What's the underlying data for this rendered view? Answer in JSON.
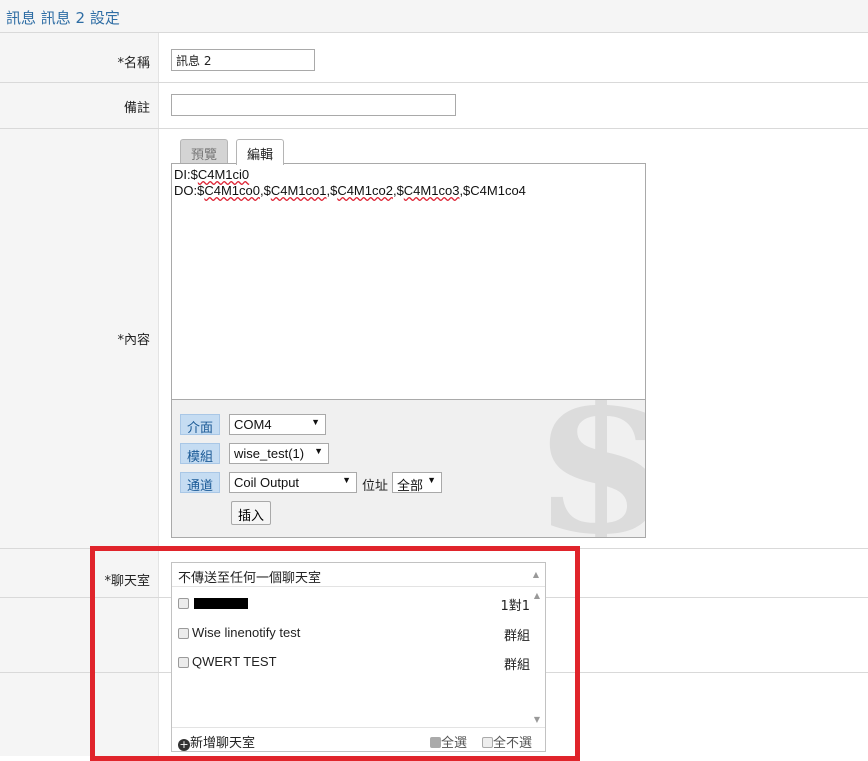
{
  "page": {
    "title": "訊息 訊息 2 設定"
  },
  "form": {
    "name_label": "*名稱",
    "name_value": "訊息 2",
    "note_label": "備註",
    "note_value": "",
    "content_label": "*內容",
    "chatroom_label": "*聊天室"
  },
  "editor": {
    "tabs": [
      {
        "label": "預覽",
        "active": false
      },
      {
        "label": "編輯",
        "active": true
      }
    ],
    "lines": {
      "line1_prefix": "DI:$",
      "line1_var": "C4M1ci0",
      "line2_prefix": "DO:$",
      "line2_var1": "C4M1co0",
      "line2_sep1": ",$",
      "line2_var2": "C4M1co1",
      "line2_sep2": ",$",
      "line2_var3": "C4M1co2",
      "line2_sep3": ",$",
      "line2_var4": "C4M1co3",
      "line2_tail": ",$C4M1co4"
    },
    "insert": {
      "interface_label": "介面",
      "interface_value": "COM4",
      "module_label": "模組",
      "module_value": "wise_test(1)",
      "channel_label": "通道",
      "channel_value": "Coil Output",
      "address_label": "位址",
      "address_value": "全部",
      "insert_button": "插入"
    }
  },
  "chatroom": {
    "header": "不傳送至任何一個聊天室",
    "items": [
      {
        "name": "",
        "redacted": true,
        "type": "1對1",
        "checked": false
      },
      {
        "name": "Wise linenotify test",
        "redacted": false,
        "type": "群組",
        "checked": false
      },
      {
        "name": "QWERT TEST",
        "redacted": false,
        "type": "群組",
        "checked": false
      }
    ],
    "add_label": "新增聊天室",
    "select_all_label": "全選",
    "select_none_label": "全不選"
  },
  "colors": {
    "title": "#2e6da4",
    "tag_bg": "#c5dcf2",
    "highlight_frame": "#e0242b",
    "label_bg": "#f5f5f5"
  }
}
